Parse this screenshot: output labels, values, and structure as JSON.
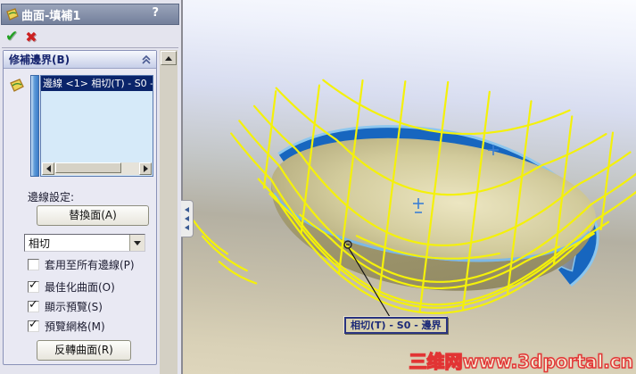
{
  "panel": {
    "title": "曲面-填補1",
    "help_label": "?",
    "section_title": "修補邊界(B)",
    "boundary_list": {
      "selected_item": "邊線 <1> 相切(T) - S0 -"
    },
    "edge_settings_label": "邊線設定:",
    "replace_face_button": "替換面(A)",
    "curvature_dropdown_value": "相切",
    "checkboxes": [
      {
        "label": "套用至所有邊線(P)",
        "checked": false
      },
      {
        "label": "最佳化曲面(O)",
        "checked": true
      },
      {
        "label": "顯示預覽(S)",
        "checked": true
      },
      {
        "label": "預覽網格(M)",
        "checked": true
      }
    ],
    "reverse_button": "反轉曲面(R)"
  },
  "viewport": {
    "callout_label": "相切(T) - S0 - 邊界",
    "watermark": "三维网www.3dportal.cn",
    "colors": {
      "preview_mesh": "#f4f10a",
      "boundary_band": "#1766bf",
      "selected_edge_highlight": "#7db9e5",
      "bowl_surface": "#b3aa7b",
      "selection_navy": "#0a246a"
    }
  }
}
